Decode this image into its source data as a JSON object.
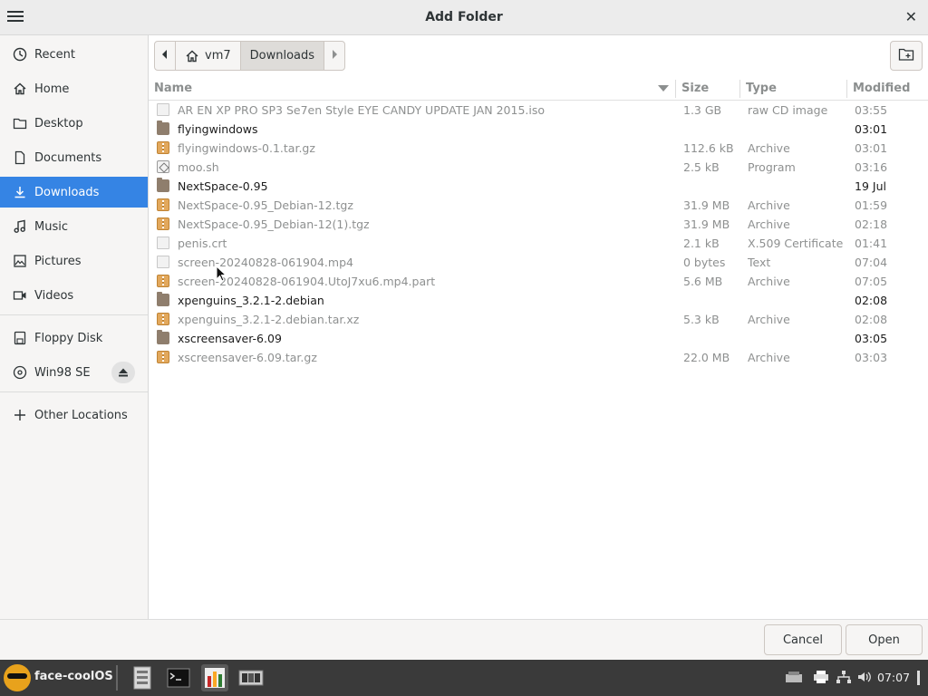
{
  "window": {
    "title": "Add Folder"
  },
  "sidebar": {
    "items": [
      {
        "label": "Recent",
        "icon": "clock-icon"
      },
      {
        "label": "Home",
        "icon": "home-icon"
      },
      {
        "label": "Desktop",
        "icon": "folder-icon"
      },
      {
        "label": "Documents",
        "icon": "document-icon"
      },
      {
        "label": "Downloads",
        "icon": "download-icon",
        "active": true
      },
      {
        "label": "Music",
        "icon": "music-icon"
      },
      {
        "label": "Pictures",
        "icon": "picture-icon"
      },
      {
        "label": "Videos",
        "icon": "video-icon"
      },
      {
        "label": "Floppy Disk",
        "icon": "floppy-icon"
      },
      {
        "label": "Win98 SE",
        "icon": "disc-icon"
      },
      {
        "label": "Other Locations",
        "icon": "plus-icon"
      }
    ]
  },
  "pathbar": {
    "home": "vm7",
    "current": "Downloads"
  },
  "columns": {
    "name": "Name",
    "size": "Size",
    "type": "Type",
    "modified": "Modified"
  },
  "files": [
    {
      "name": "AR EN XP PRO SP3 Se7en Style EYE CANDY UPDATE JAN 2015.iso",
      "size": "1.3 GB",
      "type": "raw CD image",
      "modified": "03:55",
      "kind": "doc"
    },
    {
      "name": "flyingwindows",
      "size": "",
      "type": "",
      "modified": "03:01",
      "kind": "folder"
    },
    {
      "name": "flyingwindows-0.1.tar.gz",
      "size": "112.6 kB",
      "type": "Archive",
      "modified": "03:01",
      "kind": "archive"
    },
    {
      "name": "moo.sh",
      "size": "2.5 kB",
      "type": "Program",
      "modified": "03:16",
      "kind": "program"
    },
    {
      "name": "NextSpace-0.95",
      "size": "",
      "type": "",
      "modified": "19 Jul",
      "kind": "folder"
    },
    {
      "name": "NextSpace-0.95_Debian-12.tgz",
      "size": "31.9 MB",
      "type": "Archive",
      "modified": "01:59",
      "kind": "archive"
    },
    {
      "name": "NextSpace-0.95_Debian-12(1).tgz",
      "size": "31.9 MB",
      "type": "Archive",
      "modified": "02:18",
      "kind": "archive"
    },
    {
      "name": "penis.crt",
      "size": "2.1 kB",
      "type": "X.509 Certificate",
      "modified": "01:41",
      "kind": "doc"
    },
    {
      "name": "screen-20240828-061904.mp4",
      "size": "0 bytes",
      "type": "Text",
      "modified": "07:04",
      "kind": "doc"
    },
    {
      "name": "screen-20240828-061904.UtoJ7xu6.mp4.part",
      "size": "5.6 MB",
      "type": "Archive",
      "modified": "07:05",
      "kind": "archive"
    },
    {
      "name": "xpenguins_3.2.1-2.debian",
      "size": "",
      "type": "",
      "modified": "02:08",
      "kind": "folder"
    },
    {
      "name": "xpenguins_3.2.1-2.debian.tar.xz",
      "size": "5.3 kB",
      "type": "Archive",
      "modified": "02:08",
      "kind": "archive"
    },
    {
      "name": "xscreensaver-6.09",
      "size": "",
      "type": "",
      "modified": "03:05",
      "kind": "folder"
    },
    {
      "name": "xscreensaver-6.09.tar.gz",
      "size": "22.0 MB",
      "type": "Archive",
      "modified": "03:03",
      "kind": "archive"
    }
  ],
  "buttons": {
    "cancel": "Cancel",
    "open": "Open"
  },
  "taskbar": {
    "name": "face-coolOS",
    "clock": "07:07"
  },
  "colors": {
    "accent": "#3584e4",
    "taskbar": "#3a3a3a",
    "folder": "#8f7e6d",
    "archive": "#e2a85c"
  }
}
